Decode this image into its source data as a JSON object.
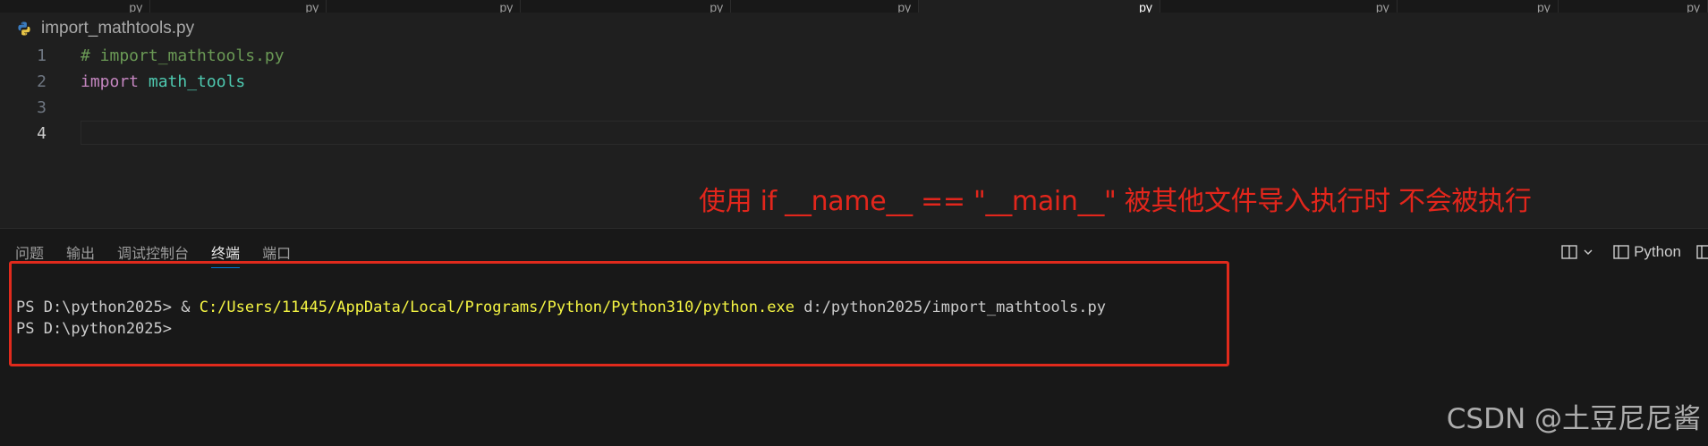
{
  "tabs": [
    {
      "ext": "py",
      "width": 168
    },
    {
      "ext": "py",
      "width": 197
    },
    {
      "ext": "py",
      "width": 217
    },
    {
      "ext": "py",
      "width": 235
    },
    {
      "ext": "py",
      "width": 210
    },
    {
      "ext": "py",
      "width": 270,
      "active": true
    },
    {
      "ext": "py",
      "width": 265
    },
    {
      "ext": "py",
      "width": 180
    },
    {
      "ext": "py",
      "width": 167
    }
  ],
  "breadcrumb": {
    "filename": "import_mathtools.py"
  },
  "editor": {
    "lines": [
      {
        "num": "1",
        "comment": "# import_mathtools.py"
      },
      {
        "num": "2",
        "keyword": "import",
        "module": "math_tools"
      },
      {
        "num": "3"
      },
      {
        "num": "4",
        "current": true
      }
    ]
  },
  "annotation": {
    "text": "使用 if __name__ == \"__main__\" 被其他文件导入执行时 不会被执行"
  },
  "panel": {
    "tabs": [
      "问题",
      "输出",
      "调试控制台",
      "终端",
      "端口"
    ],
    "active_tab": "终端",
    "actions": {
      "terminal_name": "Python"
    }
  },
  "terminal": {
    "line1_prompt": "PS D:\\python2025> & ",
    "line1_exe": "C:/Users/11445/AppData/Local/Programs/Python/Python310/python.exe",
    "line1_arg": " d:/python2025/import_mathtools.py",
    "line2_prompt": "PS D:\\python2025>"
  },
  "watermark": {
    "text": "CSDN @土豆尼尼酱"
  },
  "colors": {
    "annotation": "#e2261c",
    "exe_path": "#f5f543",
    "comment": "#6a9955",
    "keyword": "#c586c0",
    "module": "#4ec9b0"
  }
}
